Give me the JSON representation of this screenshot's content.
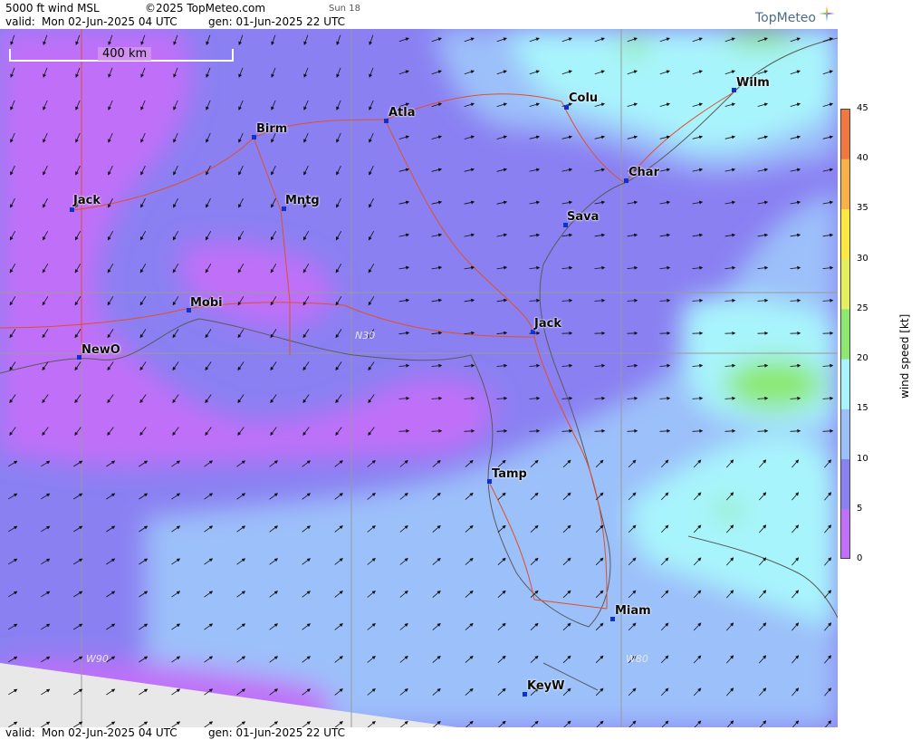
{
  "header": {
    "product": "5000 ft wind MSL",
    "copyright": "©2025 TopMeteo.com",
    "sun": "Sun 18",
    "valid_label": "valid:",
    "valid_time": "Mon  02-Jun-2025  04 UTC",
    "gen_label": "gen: 01-Jun-2025 22 UTC",
    "logo": "TopMeteo"
  },
  "footer": {
    "valid_label": "valid:",
    "valid_time": "Mon  02-Jun-2025  04 UTC",
    "gen_label": "gen: 01-Jun-2025 22 UTC"
  },
  "map": {
    "scale_label": "400 km",
    "grid_labels": [
      "N30",
      "W90",
      "W80"
    ],
    "cities": [
      {
        "name": "Atla"
      },
      {
        "name": "Colu"
      },
      {
        "name": "Wilm"
      },
      {
        "name": "Birm"
      },
      {
        "name": "Char"
      },
      {
        "name": "Jack"
      },
      {
        "name": "Mntg"
      },
      {
        "name": "Sava"
      },
      {
        "name": "Mobi"
      },
      {
        "name": "Jack"
      },
      {
        "name": "NewO"
      },
      {
        "name": "Tamp"
      },
      {
        "name": "Miam"
      },
      {
        "name": "KeyW"
      }
    ]
  },
  "colorbar": {
    "title": "wind speed  [kt]",
    "ticks": [
      "45",
      "40",
      "35",
      "30",
      "25",
      "20",
      "15",
      "10",
      "5",
      "0"
    ],
    "colors": [
      "#c070f8",
      "#8a80f2",
      "#9cc0fa",
      "#a8f4fc",
      "#8ce870",
      "#e4f060",
      "#fce840",
      "#f8b048",
      "#f07840"
    ]
  }
}
